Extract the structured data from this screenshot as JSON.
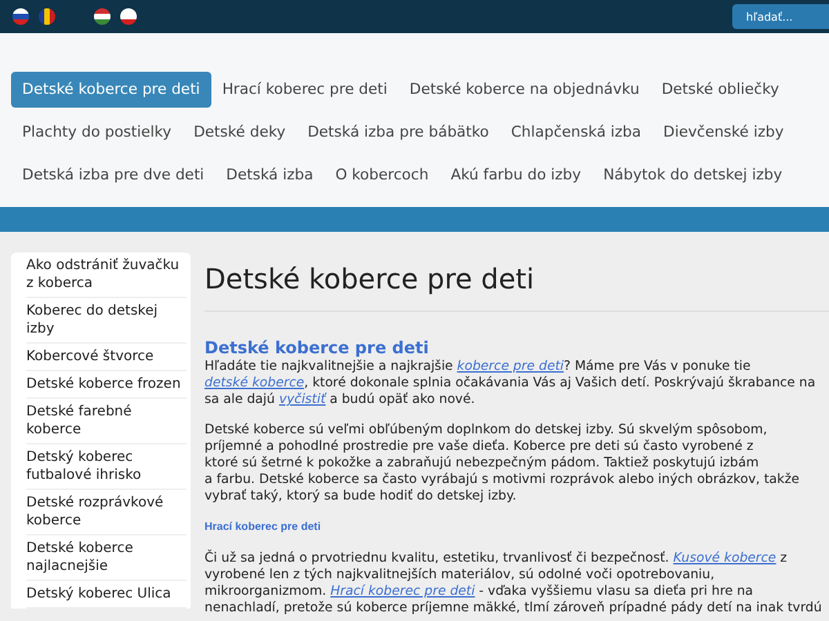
{
  "search": {
    "placeholder": "hľadať..."
  },
  "nav": [
    [
      {
        "label": "Detské koberce pre deti",
        "selected": true
      },
      {
        "label": "Hrací koberec pre deti",
        "selected": false
      },
      {
        "label": "Detské koberce na objednávku",
        "selected": false
      },
      {
        "label": "Detské obliečky",
        "selected": false
      }
    ],
    [
      {
        "label": "Plachty do postielky",
        "selected": false
      },
      {
        "label": "Detské deky",
        "selected": false
      },
      {
        "label": "Detská izba pre bábätko",
        "selected": false
      },
      {
        "label": "Chlapčenská izba",
        "selected": false
      },
      {
        "label": "Dievčenské izby",
        "selected": false
      }
    ],
    [
      {
        "label": "Detská izba pre dve deti",
        "selected": false
      },
      {
        "label": "Detská izba",
        "selected": false
      },
      {
        "label": "O kobercoch",
        "selected": false
      },
      {
        "label": "Akú farbu do izby",
        "selected": false
      },
      {
        "label": "Nábytok do detskej izby",
        "selected": false
      }
    ]
  ],
  "sidebar": [
    "Ako odstrániť žuvačku z koberca",
    "Koberec do detskej izby",
    "Kobercové štvorce",
    "Detské koberce frozen",
    "Detské farebné koberce",
    "Detský koberec futbalové ihrisko",
    "Detské rozprávkové koberce",
    "Detské koberce najlacnejšie",
    "Detský koberec Ulica"
  ],
  "title": "Detské koberce pre deti",
  "content": [
    {
      "kind": "heading",
      "text": "Detské koberce pre deti"
    },
    {
      "kind": "paragraph",
      "lines": [
        [
          {
            "text": "Hľadáte tie najkvalitnejšie a najkrajšie "
          },
          {
            "text": "koberce pre deti",
            "link": true
          },
          {
            "text": "? Máme pre Vás v ponuke tie"
          }
        ],
        [
          {
            "text": "detské koberce",
            "link": true
          },
          {
            "text": ", ktoré dokonale splnia očakávania Vás aj Vašich detí. Poskrývajú škrabance na"
          }
        ],
        [
          {
            "text": "sa ale dajú "
          },
          {
            "text": "vyčistiť",
            "link": true
          },
          {
            "text": " a budú opäť ako nové."
          }
        ]
      ]
    },
    {
      "kind": "paragraph",
      "lines": [
        [
          {
            "text": "Detské koberce sú veľmi obľúbeným doplnkom do detskej izby. Sú skvelým spôsobom,"
          }
        ],
        [
          {
            "text": "príjemné a pohodlné prostredie pre vaše dieťa. Koberce pre deti sú často vyrobené z"
          }
        ],
        [
          {
            "text": "ktoré sú šetrné k pokožke a zabraňujú nebezpečným pádom. Taktiež poskytujú izbám"
          }
        ],
        [
          {
            "text": "a farbu. Detské koberce sa často vyrábajú s motivmi rozprávok alebo iných obrázkov, takže"
          }
        ],
        [
          {
            "text": "vybrať taký, ktorý sa bude hodiť do detskej izby."
          }
        ]
      ]
    },
    {
      "kind": "subheading",
      "text": "Hrací koberec pre deti"
    },
    {
      "kind": "paragraph",
      "lines": [
        [
          {
            "text": "Či už sa jedná o prvotriednu kvalitu, estetiku, trvanlivosť či bezpečnosť. "
          },
          {
            "text": "Kusové koberce",
            "link": true
          },
          {
            "text": " z"
          }
        ],
        [
          {
            "text": "vyrobené len z tých najkvalitnejších materiálov, sú odolné voči opotrebovaniu,"
          }
        ],
        [
          {
            "text": "mikroorganizmom. "
          },
          {
            "text": "Hrací koberec pre deti",
            "link": true
          },
          {
            "text": " - vďaka vyššiemu vlasu sa dieťa pri hre na"
          }
        ],
        [
          {
            "text": "nenachladí, pretože sú koberce príjemne mäkké, tlmí zároveň prípadné pády detí na inak tvrdú"
          }
        ]
      ]
    }
  ]
}
